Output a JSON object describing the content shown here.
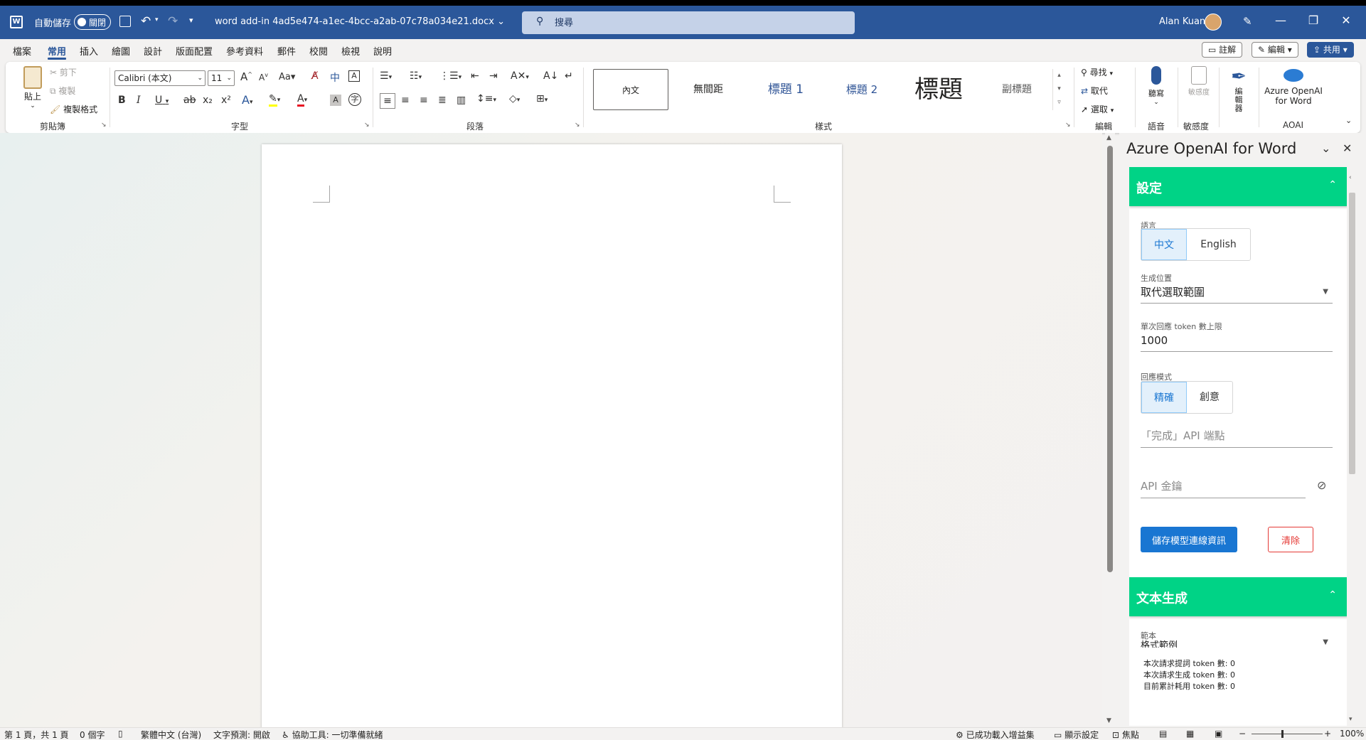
{
  "titlebar": {
    "autosave_label": "自動儲存",
    "autosave_state": "關閉",
    "doc_name": "word add-in 4ad5e474-a1ec-4bcc-a2ab-07c78a034e21.docx",
    "search_placeholder": "搜尋",
    "user_name": "Alan Kuan",
    "doc_chevron": "⌄",
    "window_controls": [
      "—",
      "❐",
      "✕"
    ]
  },
  "menu": {
    "tabs": [
      "檔案",
      "常用",
      "插入",
      "繪圖",
      "設計",
      "版面配置",
      "參考資料",
      "郵件",
      "校閱",
      "檢視",
      "說明"
    ],
    "active_tab": "常用",
    "comment_btn": "註解",
    "editing_btn": "編輯",
    "share_btn": "共用"
  },
  "ribbon": {
    "clipboard": {
      "paste": "貼上",
      "cut": "剪下",
      "copy": "複製",
      "format_painter": "複製格式",
      "group_label": "剪貼簿"
    },
    "font": {
      "font_name": "Calibri (本文)",
      "font_size": "11",
      "group_label": "字型",
      "grow": "A",
      "shrink": "A",
      "case": "Aa",
      "bold": "B",
      "italic": "I",
      "underline": "U",
      "strike": "ab",
      "subscript": "x₂",
      "superscript": "x²",
      "text_effect": "A",
      "font_color": "A",
      "char_shading": "A",
      "char_border": "A",
      "phonetic": "中"
    },
    "paragraph": {
      "group_label": "段落"
    },
    "styles": {
      "items": [
        "內文",
        "無間距",
        "標題 1",
        "標題 2",
        "標題",
        "副標題"
      ],
      "group_label": "樣式"
    },
    "editing": {
      "find": "尋找",
      "replace": "取代",
      "select": "選取",
      "group_label": "編輯"
    },
    "voice": {
      "dictate": "聽寫",
      "group_label": "語音"
    },
    "sensitivity": {
      "label": "敏感度",
      "group_label": "敏感度"
    },
    "editor": {
      "label": "編輯器"
    },
    "aoai": {
      "label_line1": "Azure OpenAI",
      "label_line2": "for Word",
      "group_label": "AOAI"
    }
  },
  "pane": {
    "title": "Azure OpenAI for Word",
    "settings": {
      "header": "設定",
      "language_label": "語言",
      "language_options": [
        "中文",
        "English"
      ],
      "language_selected": "中文",
      "position_label": "生成位置",
      "position_value": "取代選取範圍",
      "token_label": "單次回應 token 數上限",
      "token_value": "1000",
      "mode_label": "回應模式",
      "mode_options": [
        "精確",
        "創意"
      ],
      "mode_selected": "精確",
      "endpoint_placeholder": "「完成」API 端點",
      "apikey_placeholder": "API 金鑰",
      "save_button": "儲存模型連線資訊",
      "clear_button": "清除"
    },
    "textgen": {
      "header": "文本生成",
      "template_label": "範本",
      "template_value": "格式範例",
      "prompt_tokens": "本次請求提詞 token 數: 0",
      "completion_tokens": "本次請求生成 token 數: 0",
      "total_tokens": "目前累計耗用 token 數: 0"
    }
  },
  "statusbar": {
    "page_info": "第 1 頁，共 1 頁",
    "word_count": "0 個字",
    "language": "繁體中文 (台灣)",
    "text_prediction": "文字預測: 開啟",
    "accessibility": "協助工具: 一切準備就緒",
    "addin_status": "已成功載入增益集",
    "display_settings": "顯示設定",
    "focus": "焦點",
    "zoom": "100%"
  },
  "colors": {
    "title_blue": "#2b579a",
    "pane_accent_green": "#00d386",
    "primary_button": "#1976d2",
    "danger": "#e53935"
  }
}
